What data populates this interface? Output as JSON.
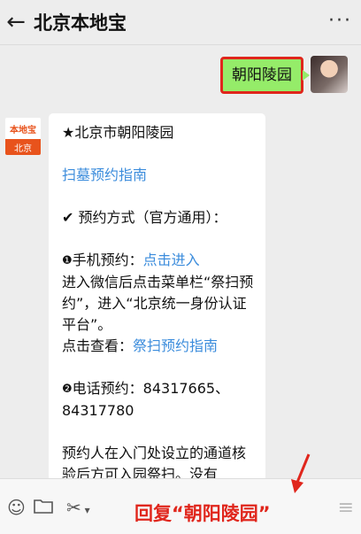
{
  "header": {
    "back_icon": "arrow-left-icon",
    "title": "北京本地宝",
    "more_label": "···"
  },
  "outgoing": {
    "text": "朝阳陵园"
  },
  "bot": {
    "logo_top": "本地宝",
    "logo_bottom": "北京"
  },
  "incoming": {
    "line1": "★北京市朝阳陵园",
    "link1": "扫墓预约指南",
    "method_check": "✔",
    "method_title": "预约方式（官方通用）：",
    "phone_num": "❶",
    "phone_label": "手机预约：",
    "phone_link": "点击进入",
    "phone_desc": "进入微信后点击菜单栏“祭扫预约”，进入“北京统一身份认证平台”。",
    "view_label": "点击查看：",
    "view_link": "祭扫预约指南",
    "tel_num": "❷",
    "tel_text": "电话预约：84317665、84317780",
    "more_text": "预约人在入门处设立的通道核验后方可入园祭扫。没有"
  },
  "bottom": {
    "reply_hint": "回复“朝阳陵园”"
  },
  "colors": {
    "accent_red": "#e0261c",
    "bubble_green": "#95ec69",
    "link_blue": "#3b8cdc"
  }
}
